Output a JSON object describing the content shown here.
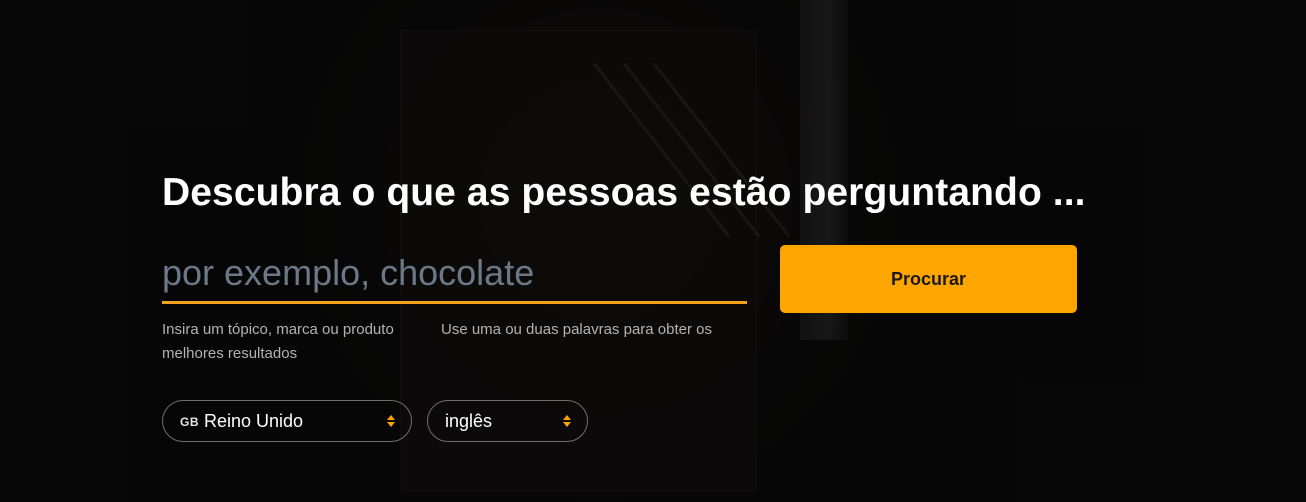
{
  "hero": {
    "title": "Descubra o que as pessoas estão perguntando ..."
  },
  "search": {
    "placeholder": "por exemplo, chocolate",
    "value": "",
    "button_label": "Procurar",
    "hint_topic": "Insira um tópico, marca ou produto melhores resultados",
    "hint_words": "Use uma ou duas palavras para obter os"
  },
  "filters": {
    "country": {
      "flag": "GB",
      "value": "Reino Unido",
      "icon": "sort-arrows-icon"
    },
    "language": {
      "value": "inglês",
      "icon": "sort-arrows-icon"
    }
  },
  "colors": {
    "accent": "#ffa500",
    "underline": "#f6a31b",
    "background": "#0b0a0a",
    "placeholder": "#6b7888"
  }
}
